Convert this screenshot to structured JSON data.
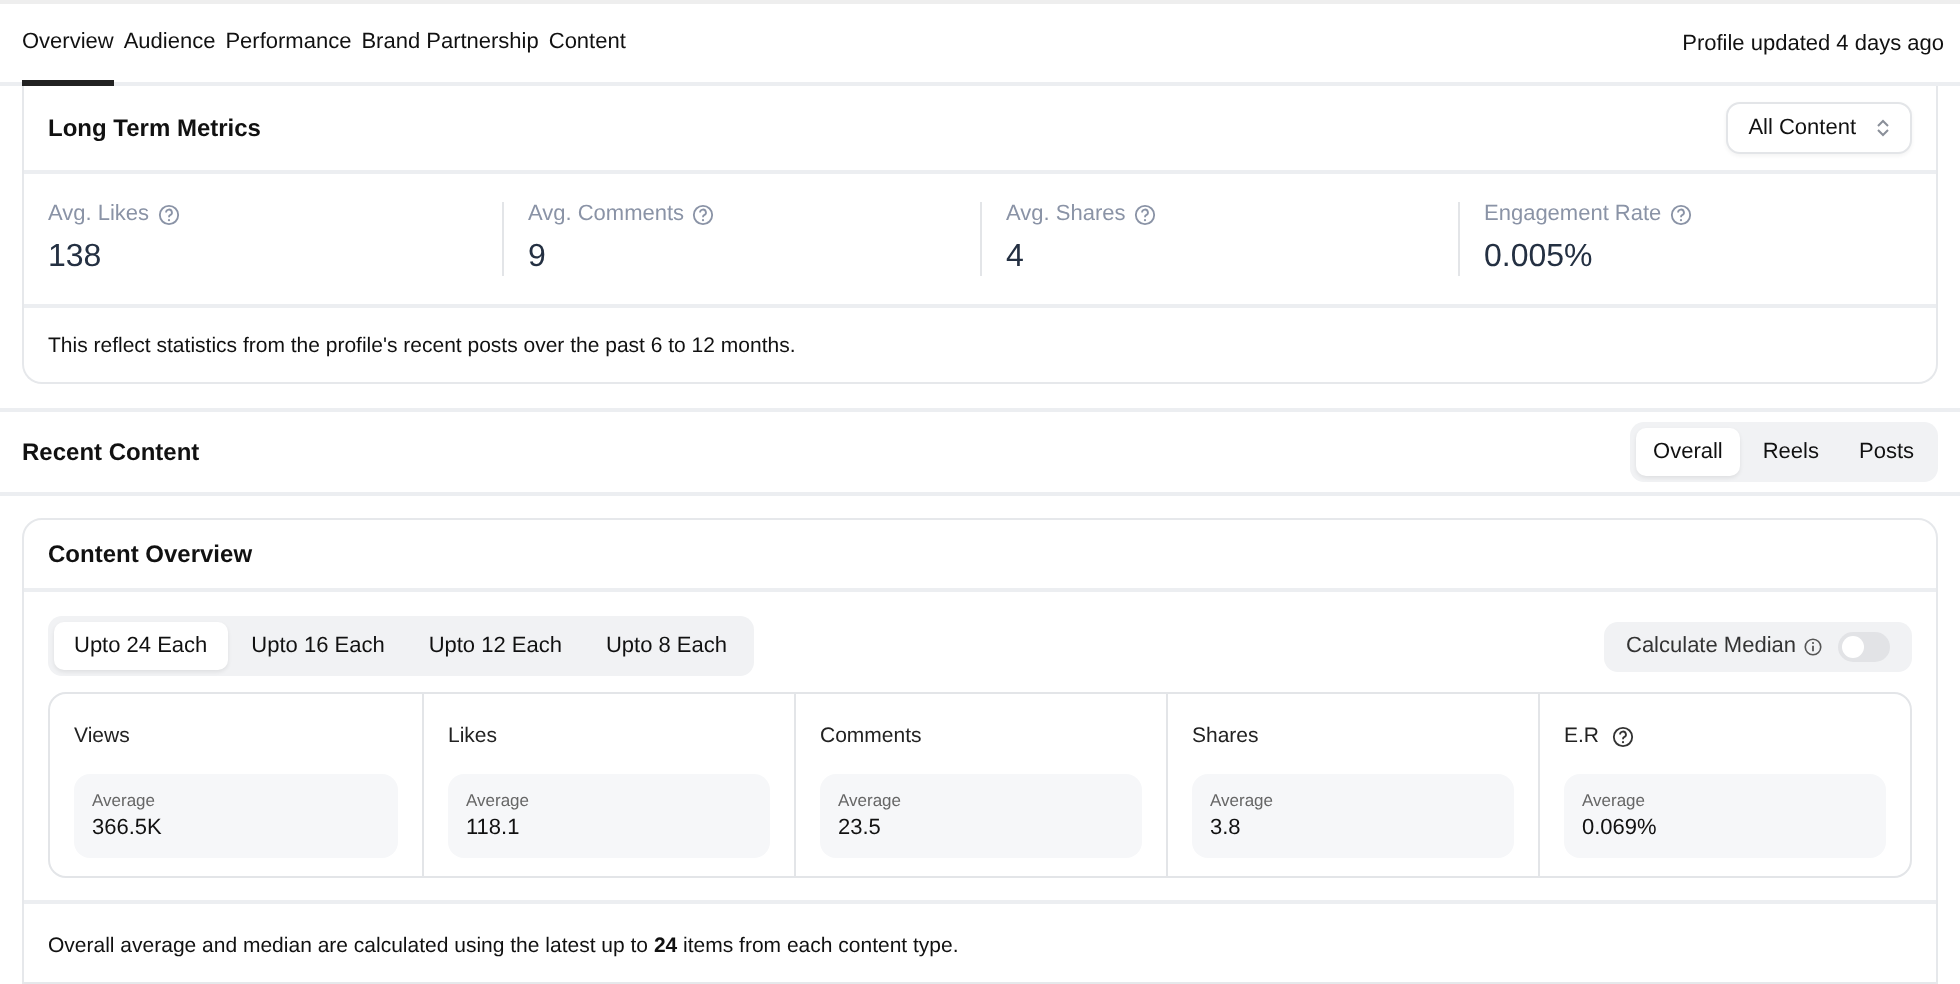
{
  "nav": {
    "tabs": [
      {
        "label": "Overview",
        "selected": true
      },
      {
        "label": "Audience",
        "selected": false
      },
      {
        "label": "Performance",
        "selected": false
      },
      {
        "label": "Brand Partnership",
        "selected": false
      },
      {
        "label": "Content",
        "selected": false
      }
    ],
    "updated": "Profile updated 4 days ago"
  },
  "long_term": {
    "title": "Long Term Metrics",
    "filter": "All Content",
    "metrics": [
      {
        "label": "Avg. Likes",
        "value": "138"
      },
      {
        "label": "Avg. Comments",
        "value": "9"
      },
      {
        "label": "Avg. Shares",
        "value": "4"
      },
      {
        "label": "Engagement Rate",
        "value": "0.005%"
      }
    ],
    "note": "This reflect statistics from the profile's recent posts over the past 6 to 12 months."
  },
  "recent": {
    "title": "Recent Content",
    "tabs": [
      {
        "label": "Overall",
        "selected": true
      },
      {
        "label": "Reels",
        "selected": false
      },
      {
        "label": "Posts",
        "selected": false
      }
    ]
  },
  "overview": {
    "title": "Content Overview",
    "ranges": [
      {
        "label": "Upto 24 Each",
        "selected": true
      },
      {
        "label": "Upto 16 Each",
        "selected": false
      },
      {
        "label": "Upto 12 Each",
        "selected": false
      },
      {
        "label": "Upto 8 Each",
        "selected": false
      }
    ],
    "median": {
      "label": "Calculate Median",
      "on": false
    },
    "stats": [
      {
        "label": "Views",
        "help": false,
        "sub": "Average",
        "value": "366.5K"
      },
      {
        "label": "Likes",
        "help": false,
        "sub": "Average",
        "value": "118.1"
      },
      {
        "label": "Comments",
        "help": false,
        "sub": "Average",
        "value": "23.5"
      },
      {
        "label": "Shares",
        "help": false,
        "sub": "Average",
        "value": "3.8"
      },
      {
        "label": "E.R",
        "help": true,
        "sub": "Average",
        "value": "0.069%"
      }
    ],
    "note": "Overall average and median are calculated using the latest up to **24** items from each content type."
  }
}
